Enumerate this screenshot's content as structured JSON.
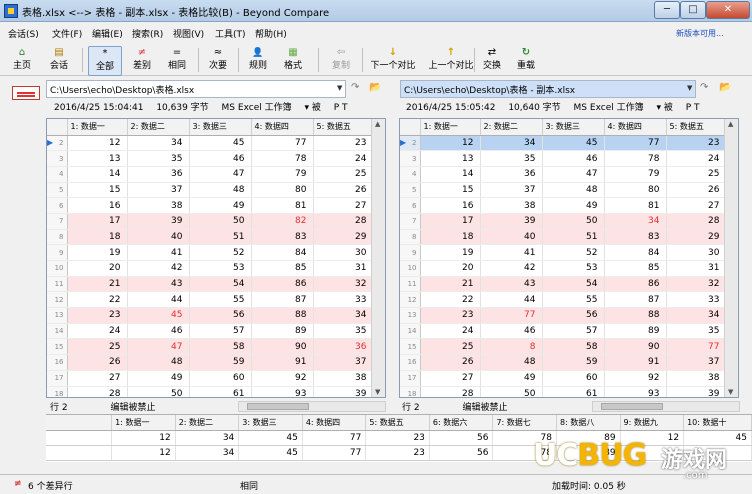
{
  "window": {
    "title": "表格.xlsx <--> 表格 - 副本.xlsx - 表格比较(B) - Beyond Compare",
    "min_label": "─",
    "max_label": "□",
    "close_label": "✕"
  },
  "menu": {
    "items": [
      "会话(S)",
      "文件(F)",
      "编辑(E)",
      "搜索(R)",
      "视图(V)",
      "工具(T)",
      "帮助(H)"
    ],
    "new_version_link": "新版本可用..."
  },
  "toolbar": {
    "buttons": [
      {
        "label": "主页",
        "icon": "home-icon",
        "glyph": "⌂"
      },
      {
        "label": "会话",
        "icon": "session-icon",
        "glyph": "▤"
      },
      {
        "label": "全部",
        "icon": "all-icon",
        "glyph": "*"
      },
      {
        "label": "差别",
        "icon": "diff-icon",
        "glyph": "≠"
      },
      {
        "label": "相同",
        "icon": "same-icon",
        "glyph": "="
      },
      {
        "label": "次要",
        "icon": "minor-icon",
        "glyph": "≈"
      },
      {
        "label": "规则",
        "icon": "rules-icon",
        "glyph": "👤"
      },
      {
        "label": "格式",
        "icon": "format-icon",
        "glyph": "▦"
      },
      {
        "label": "复制",
        "icon": "copy-icon",
        "glyph": "⇦"
      },
      {
        "label": "下一个对比",
        "icon": "next-diff-icon",
        "glyph": "↓"
      },
      {
        "label": "上一个对比",
        "icon": "prev-diff-icon",
        "glyph": "↑"
      },
      {
        "label": "交换",
        "icon": "swap-icon",
        "glyph": "⇄"
      },
      {
        "label": "重载",
        "icon": "reload-icon",
        "glyph": "↻"
      }
    ]
  },
  "left": {
    "path": "C:\\Users\\echo\\Desktop\\表格.xlsx",
    "date": "2016/4/25 15:04:41",
    "size": "10,639 字节",
    "format": "MS Excel 工作簿",
    "extra": "▾  被",
    "flags": "P  T",
    "status": "行 2",
    "edit_status": "编辑被禁止"
  },
  "right": {
    "path": "C:\\Users\\echo\\Desktop\\表格 - 副本.xlsx",
    "date": "2016/4/25 15:05:42",
    "size": "10,640 字节",
    "format": "MS Excel 工作簿",
    "extra": "▾  被",
    "flags": "P  T",
    "status": "行 2",
    "edit_status": "编辑被禁止"
  },
  "columns": [
    "1: 数据一",
    "2: 数据二",
    "3: 数据三",
    "4: 数据四",
    "5: 数据五"
  ],
  "rows_left": [
    {
      "n": "2",
      "v": [
        "12",
        "34",
        "45",
        "77",
        "23"
      ],
      "diff": false,
      "red": []
    },
    {
      "n": "3",
      "v": [
        "13",
        "35",
        "46",
        "78",
        "24"
      ],
      "diff": false,
      "red": []
    },
    {
      "n": "4",
      "v": [
        "14",
        "36",
        "47",
        "79",
        "25"
      ],
      "diff": false,
      "red": []
    },
    {
      "n": "5",
      "v": [
        "15",
        "37",
        "48",
        "80",
        "26"
      ],
      "diff": false,
      "red": []
    },
    {
      "n": "6",
      "v": [
        "16",
        "38",
        "49",
        "81",
        "27"
      ],
      "diff": false,
      "red": []
    },
    {
      "n": "7",
      "v": [
        "17",
        "39",
        "50",
        "82",
        "28"
      ],
      "diff": true,
      "red": [
        3
      ]
    },
    {
      "n": "8",
      "v": [
        "18",
        "40",
        "51",
        "83",
        "29"
      ],
      "diff": true,
      "red": []
    },
    {
      "n": "9",
      "v": [
        "19",
        "41",
        "52",
        "84",
        "30"
      ],
      "diff": false,
      "red": []
    },
    {
      "n": "10",
      "v": [
        "20",
        "42",
        "53",
        "85",
        "31"
      ],
      "diff": false,
      "red": []
    },
    {
      "n": "11",
      "v": [
        "21",
        "43",
        "54",
        "86",
        "32"
      ],
      "diff": true,
      "red": []
    },
    {
      "n": "12",
      "v": [
        "22",
        "44",
        "55",
        "87",
        "33"
      ],
      "diff": false,
      "red": []
    },
    {
      "n": "13",
      "v": [
        "23",
        "45",
        "56",
        "88",
        "34"
      ],
      "diff": true,
      "red": [
        1
      ]
    },
    {
      "n": "14",
      "v": [
        "24",
        "46",
        "57",
        "89",
        "35"
      ],
      "diff": false,
      "red": []
    },
    {
      "n": "15",
      "v": [
        "25",
        "47",
        "58",
        "90",
        "36"
      ],
      "diff": true,
      "red": [
        1,
        4
      ]
    },
    {
      "n": "16",
      "v": [
        "26",
        "48",
        "59",
        "91",
        "37"
      ],
      "diff": true,
      "red": []
    },
    {
      "n": "17",
      "v": [
        "27",
        "49",
        "60",
        "92",
        "38"
      ],
      "diff": false,
      "red": []
    },
    {
      "n": "18",
      "v": [
        "28",
        "50",
        "61",
        "93",
        "39"
      ],
      "diff": false,
      "red": []
    }
  ],
  "rows_right": [
    {
      "n": "2",
      "v": [
        "12",
        "34",
        "45",
        "77",
        "23"
      ],
      "diff": false,
      "red": []
    },
    {
      "n": "3",
      "v": [
        "13",
        "35",
        "46",
        "78",
        "24"
      ],
      "diff": false,
      "red": []
    },
    {
      "n": "4",
      "v": [
        "14",
        "36",
        "47",
        "79",
        "25"
      ],
      "diff": false,
      "red": []
    },
    {
      "n": "5",
      "v": [
        "15",
        "37",
        "48",
        "80",
        "26"
      ],
      "diff": false,
      "red": []
    },
    {
      "n": "6",
      "v": [
        "16",
        "38",
        "49",
        "81",
        "27"
      ],
      "diff": false,
      "red": []
    },
    {
      "n": "7",
      "v": [
        "17",
        "39",
        "50",
        "34",
        "28"
      ],
      "diff": true,
      "red": [
        3
      ]
    },
    {
      "n": "8",
      "v": [
        "18",
        "40",
        "51",
        "83",
        "29"
      ],
      "diff": true,
      "red": []
    },
    {
      "n": "9",
      "v": [
        "19",
        "41",
        "52",
        "84",
        "30"
      ],
      "diff": false,
      "red": []
    },
    {
      "n": "10",
      "v": [
        "20",
        "42",
        "53",
        "85",
        "31"
      ],
      "diff": false,
      "red": []
    },
    {
      "n": "11",
      "v": [
        "21",
        "43",
        "54",
        "86",
        "32"
      ],
      "diff": true,
      "red": []
    },
    {
      "n": "12",
      "v": [
        "22",
        "44",
        "55",
        "87",
        "33"
      ],
      "diff": false,
      "red": []
    },
    {
      "n": "13",
      "v": [
        "23",
        "77",
        "56",
        "88",
        "34"
      ],
      "diff": true,
      "red": [
        1
      ]
    },
    {
      "n": "14",
      "v": [
        "24",
        "46",
        "57",
        "89",
        "35"
      ],
      "diff": false,
      "red": []
    },
    {
      "n": "15",
      "v": [
        "25",
        "8",
        "58",
        "90",
        "77"
      ],
      "diff": true,
      "red": [
        1,
        4
      ]
    },
    {
      "n": "16",
      "v": [
        "26",
        "48",
        "59",
        "91",
        "37"
      ],
      "diff": true,
      "red": []
    },
    {
      "n": "17",
      "v": [
        "27",
        "49",
        "60",
        "92",
        "38"
      ],
      "diff": false,
      "red": []
    },
    {
      "n": "18",
      "v": [
        "28",
        "50",
        "61",
        "93",
        "39"
      ],
      "diff": false,
      "red": []
    }
  ],
  "bottom": {
    "columns": [
      "1: 数据一",
      "2: 数据二",
      "3: 数据三",
      "4: 数据四",
      "5: 数据五",
      "6: 数据六",
      "7: 数据七",
      "8: 数据八",
      "9: 数据九",
      "10: 数据十"
    ],
    "row1": [
      "12",
      "34",
      "45",
      "77",
      "23",
      "56",
      "78",
      "89",
      "12",
      "45"
    ],
    "row2": [
      "12",
      "34",
      "45",
      "77",
      "23",
      "56",
      "78",
      "89",
      "",
      ""
    ]
  },
  "statusbar": {
    "diff_count": "6 个差异行",
    "same": "相同",
    "load_time": "加载时间: 0.05 秒"
  },
  "watermark": {
    "brand_a": "UC",
    "brand_b": "BUG",
    "brand_cn": "游戏网",
    "domain": ".com"
  },
  "colors": {
    "diff_row": "#fde3e3",
    "diff_text": "#e03030",
    "current_row": "#b8d3f2"
  }
}
